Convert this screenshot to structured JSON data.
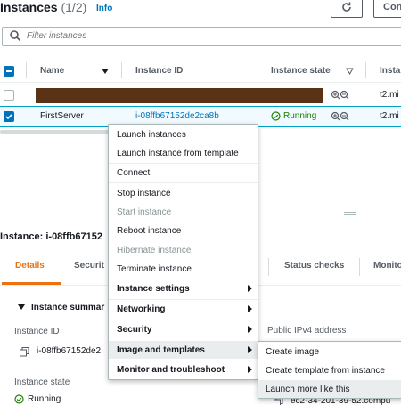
{
  "header": {
    "title": "Instances",
    "count": "(1/2)",
    "info": "Info",
    "connect_label": "Con"
  },
  "search": {
    "placeholder": "Filter instances"
  },
  "table": {
    "columns": [
      "Name",
      "Instance ID",
      "Instance state",
      "Insta"
    ],
    "rows": [
      {
        "name": "",
        "instance_id": "",
        "state": "",
        "type": "t2.mi",
        "selected": false
      },
      {
        "name": "FirstServer",
        "instance_id": "i-08ffb67152de2ca8b",
        "state": "Running",
        "type": "t2.mi",
        "selected": true
      }
    ]
  },
  "details": {
    "title": "Instance: i-08ffb67152",
    "tabs": [
      "Details",
      "Securit",
      "Status checks",
      "Monito"
    ],
    "section_title": "Instance summar",
    "fields": {
      "instance_id_label": "Instance ID",
      "instance_id_value": "i-08ffb67152de2",
      "instance_state_label": "Instance state",
      "instance_state_value": "Running",
      "public_ipv4_label": "Public IPv4 address",
      "public_ipv4_value": "ec2-34-201-39-52.compu"
    }
  },
  "context_menu": {
    "items": [
      {
        "label": "Launch instances",
        "disabled": false,
        "submenu": false
      },
      {
        "label": "Launch instance from template",
        "disabled": false,
        "submenu": false
      },
      {
        "label": "Connect",
        "disabled": false,
        "submenu": false
      },
      {
        "label": "Stop instance",
        "disabled": false,
        "submenu": false
      },
      {
        "label": "Start instance",
        "disabled": true,
        "submenu": false
      },
      {
        "label": "Reboot instance",
        "disabled": false,
        "submenu": false
      },
      {
        "label": "Hibernate instance",
        "disabled": true,
        "submenu": false
      },
      {
        "label": "Terminate instance",
        "disabled": false,
        "submenu": false
      },
      {
        "label": "Instance settings",
        "disabled": false,
        "submenu": true
      },
      {
        "label": "Networking",
        "disabled": false,
        "submenu": true
      },
      {
        "label": "Security",
        "disabled": false,
        "submenu": true
      },
      {
        "label": "Image and templates",
        "disabled": false,
        "submenu": true,
        "active": true
      },
      {
        "label": "Monitor and troubleshoot",
        "disabled": false,
        "submenu": true
      }
    ]
  },
  "submenu": {
    "items": [
      {
        "label": "Create image"
      },
      {
        "label": "Create template from instance"
      },
      {
        "label": "Launch more like this",
        "hover": true
      }
    ]
  },
  "colors": {
    "link": "#0073bb",
    "running": "#1d8102",
    "active_tab": "#ec7211",
    "redacted": "#5a3317"
  },
  "icons": [
    "refresh-icon",
    "search-icon",
    "sort-down-icon",
    "filter-icon",
    "zoom-in-icon",
    "zoom-out-icon",
    "check-icon",
    "status-running-icon",
    "copy-icon",
    "chevron-right-icon",
    "caret-down-icon"
  ]
}
